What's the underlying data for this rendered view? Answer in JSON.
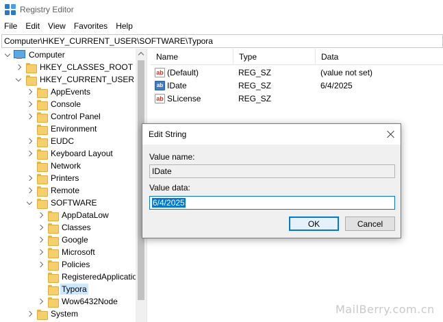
{
  "window": {
    "title": "Registry Editor"
  },
  "menu": [
    "File",
    "Edit",
    "View",
    "Favorites",
    "Help"
  ],
  "address": "Computer\\HKEY_CURRENT_USER\\SOFTWARE\\Typora",
  "tree": [
    {
      "label": "Computer",
      "icon": "computer-icon",
      "expander": "down"
    },
    {
      "label": "HKEY_CLASSES_ROOT",
      "icon": "folder-icon",
      "expander": "right"
    },
    {
      "label": "HKEY_CURRENT_USER",
      "icon": "folder-icon",
      "expander": "down"
    },
    {
      "label": "AppEvents",
      "icon": "folder-icon",
      "expander": "right"
    },
    {
      "label": "Console",
      "icon": "folder-icon",
      "expander": "right"
    },
    {
      "label": "Control Panel",
      "icon": "folder-icon",
      "expander": "right"
    },
    {
      "label": "Environment",
      "icon": "folder-icon",
      "expander": "none"
    },
    {
      "label": "EUDC",
      "icon": "folder-icon",
      "expander": "right"
    },
    {
      "label": "Keyboard Layout",
      "icon": "folder-icon",
      "expander": "right"
    },
    {
      "label": "Network",
      "icon": "folder-icon",
      "expander": "none"
    },
    {
      "label": "Printers",
      "icon": "folder-icon",
      "expander": "right"
    },
    {
      "label": "Remote",
      "icon": "folder-icon",
      "expander": "right"
    },
    {
      "label": "SOFTWARE",
      "icon": "folder-icon",
      "expander": "down"
    },
    {
      "label": "AppDataLow",
      "icon": "folder-icon",
      "expander": "right"
    },
    {
      "label": "Classes",
      "icon": "folder-icon",
      "expander": "right"
    },
    {
      "label": "Google",
      "icon": "folder-icon",
      "expander": "right"
    },
    {
      "label": "Microsoft",
      "icon": "folder-icon",
      "expander": "right"
    },
    {
      "label": "Policies",
      "icon": "folder-icon",
      "expander": "right"
    },
    {
      "label": "RegisteredApplicatio",
      "icon": "folder-icon",
      "expander": "none"
    },
    {
      "label": "Typora",
      "icon": "folder-icon",
      "expander": "none",
      "selected": true
    },
    {
      "label": "Wow6432Node",
      "icon": "folder-icon",
      "expander": "right"
    },
    {
      "label": "System",
      "icon": "folder-icon",
      "expander": "right"
    }
  ],
  "list": {
    "columns": [
      "Name",
      "Type",
      "Data"
    ],
    "rows": [
      {
        "name": "(Default)",
        "type": "REG_SZ",
        "data": "(value not set)",
        "icon": "string-value-icon"
      },
      {
        "name": "IDate",
        "type": "REG_SZ",
        "data": "6/4/2025",
        "icon": "binary-value-icon"
      },
      {
        "name": "SLicense",
        "type": "REG_SZ",
        "data": "",
        "icon": "string-value-icon"
      }
    ]
  },
  "dialog": {
    "title": "Edit String",
    "value_name_label": "Value name:",
    "value_name": "IDate",
    "value_data_label": "Value data:",
    "value_data": "6/4/2025",
    "ok_label": "OK",
    "cancel_label": "Cancel"
  },
  "watermark": "MailBerry.com.cn",
  "colors": {
    "accent": "#0078d7",
    "selection": "#cce8ff",
    "folder": "#f6cf6a"
  }
}
